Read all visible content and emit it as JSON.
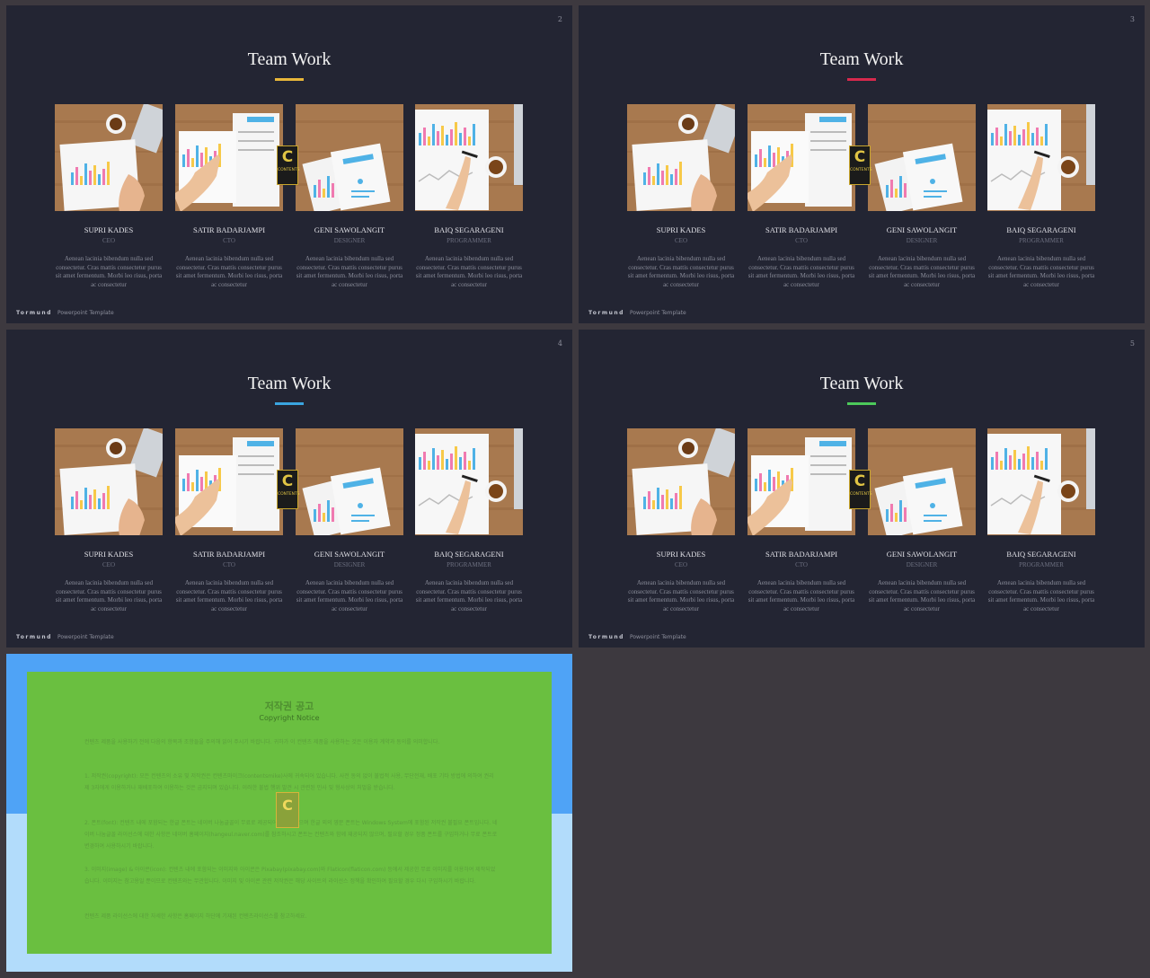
{
  "slides": [
    {
      "page": "2",
      "title": "Team Work",
      "accent": "#e8b73a"
    },
    {
      "page": "3",
      "title": "Team Work",
      "accent": "#d8294d"
    },
    {
      "page": "4",
      "title": "Team Work",
      "accent": "#3aa5e0"
    },
    {
      "page": "5",
      "title": "Team Work",
      "accent": "#4cc95a"
    }
  ],
  "members": [
    {
      "name": "SUPRI KADES",
      "role": "CEO",
      "desc": "Aenean lacinia bibendum nulla sed consectetur. Cras mattis consectetur purus sit amet fermentum. Morbi leo risus, porta ac consectetur"
    },
    {
      "name": "SATIR BADARJAMPI",
      "role": "CTO",
      "desc": "Aenean lacinia bibendum nulla sed consectetur. Cras mattis consectetur purus sit amet fermentum. Morbi leo risus, porta ac consectetur"
    },
    {
      "name": "GENI SAWOLANGIT",
      "role": "DESIGNER",
      "desc": "Aenean lacinia bibendum nulla sed consectetur. Cras mattis consectetur purus sit amet fermentum. Morbi leo risus, porta ac consectetur"
    },
    {
      "name": "BAIQ SEGARAGENI",
      "role": "PROGRAMMER",
      "desc": "Aenean lacinia bibendum nulla sed consectetur. Cras mattis consectetur purus sit amet fermentum. Morbi leo risus, porta ac consectetur"
    }
  ],
  "footer": {
    "brand": "Tormund",
    "text": "Powerpoint  Template"
  },
  "watermark": {
    "letter": "C",
    "text": "CONTENTS"
  },
  "copyright": {
    "title": "저작권 공고",
    "subtitle": "Copyright Notice",
    "paragraphs": [
      "컨텐츠 제품을 사용하기 전에 다음의 항목과 조항들을 주의해 읽어 주시기 바랍니다. 귀하가 이 컨텐츠 제품을 사용하는 것은 이용자 계약과 동의를 의미합니다.",
      "1. 저작권(copyright): 모든 컨텐츠의 소유 및 저작권은 컨텐츠마이크(contentsmike)사에 귀속되어 있습니다. 사전 동의 없이 불법적 사용, 무단전재, 배포 기타 방법에 의하여 권리 제 3자에게 이용하거나 재배포하여 이용하는 것은 금지되며 있습니다. 이러한 불법 행위 발견 시 관련된 민사 및 형사상의 처벌을 받습니다.",
      "2. 폰트(font): 컨텐츠 내에 포함되는 한글 폰트는 네이버 나눔글꼴이 무료로 제공되어 제작되었으며 한글 외의 영문 폰트는 Windows System에 포함된 저작권 불필요 폰트입니다. 네이버 나눔글꼴 라이선스에 대한 사항은 네이버 홈페이지(hangeul.naver.com)를 참조하시고 폰트는 컨텐츠와 함께 재공되지 않으며, 필요할 경우 정품 폰트를 구입하거나 무료 폰트로 변경하여 사용하시기 바랍니다.",
      "3. 이미지(image) & 아이콘(icon): 컨텐츠 내에 포함되는 이미지와 아이콘은 Pixabay(pixabay.com)와 Flaticon(flaticon.com) 등에서 제공한 무료 이미지를 이용하여 제작되었습니다. 이미지는 참고용일 뿐이므로 컨텐츠와는 무관합니다. 이미지 및 아이콘 관련 저작권은 해당 사이트의 라이선스 정책을 확인하여 필요할 경우 다시 구입하시기 바랍니다.",
      "컨텐츠 제품 라이선스에 대한 자세한 사항은 홈페이지 하단에 기재된 컨텐츠라이선스를 참고하세요."
    ]
  }
}
